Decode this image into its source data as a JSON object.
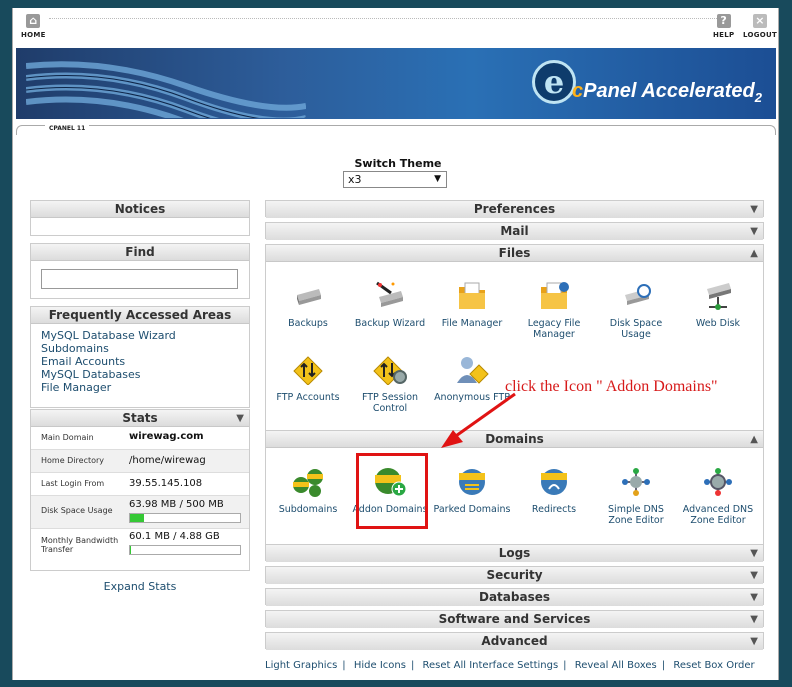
{
  "topnav": {
    "home": "HOME",
    "help": "HELP",
    "logout": "LOGOUT"
  },
  "banner": {
    "brand_c": "c",
    "brand_panel": "Panel",
    "brand_accel": "Accelerated",
    "brand_ver": "2",
    "edition": "CPANEL 11"
  },
  "theme": {
    "label": "Switch Theme",
    "value": "x3"
  },
  "left": {
    "notices": "Notices",
    "find": "Find",
    "faa_title": "Frequently Accessed Areas",
    "faa_items": [
      "MySQL Database Wizard",
      "Subdomains",
      "Email Accounts",
      "MySQL Databases",
      "File Manager"
    ],
    "stats_title": "Stats",
    "stats": [
      {
        "k": "Main Domain",
        "v": "wirewag.com"
      },
      {
        "k": "Home Directory",
        "v": "/home/wirewag"
      },
      {
        "k": "Last Login From",
        "v": "39.55.145.108"
      },
      {
        "k": "Disk Space Usage",
        "v": "63.98 MB / 500 MB",
        "progress": 0.128
      },
      {
        "k": "Monthly Bandwidth Transfer",
        "v": "60.1 MB / 4.88 GB",
        "progress": 0.012
      }
    ],
    "expand": "Expand Stats"
  },
  "sections": {
    "preferences": "Preferences",
    "mail": "Mail",
    "files": "Files",
    "domains": "Domains",
    "logs": "Logs",
    "security": "Security",
    "databases": "Databases",
    "software": "Software and Services",
    "advanced": "Advanced"
  },
  "files_icons": [
    "Backups",
    "Backup Wizard",
    "File Manager",
    "Legacy File Manager",
    "Disk Space Usage",
    "Web Disk",
    "FTP Accounts",
    "FTP Session Control",
    "Anonymous FTP"
  ],
  "domains_icons": [
    "Subdomains",
    "Addon Domains",
    "Parked Domains",
    "Redirects",
    "Simple DNS Zone Editor",
    "Advanced DNS Zone Editor"
  ],
  "annotation": "click the Icon \" Addon Domains\"",
  "footer": {
    "light": "Light Graphics",
    "hide": "Hide Icons",
    "reset_settings": "Reset All Interface Settings",
    "reveal": "Reveal All Boxes",
    "reset_box": "Reset Box Order",
    "sep": "|"
  },
  "colors": {
    "accent": "#1d4d6e",
    "annotation": "#d71a1a",
    "background": "#184a5c"
  }
}
